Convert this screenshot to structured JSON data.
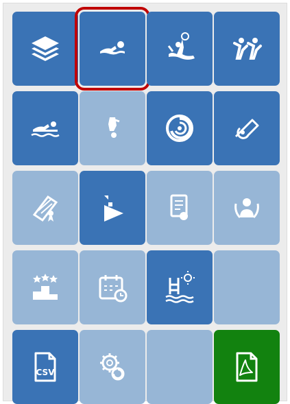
{
  "colors": {
    "panel_bg": "#ececec",
    "tile_dark": "#3a73b5",
    "tile_light": "#97b6d6",
    "tile_green": "#12820f",
    "selection_outline": "#c00000",
    "icon": "#ffffff"
  },
  "tiles": [
    {
      "icon": "layers-icon",
      "style": "dark"
    },
    {
      "icon": "swimmer-icon",
      "style": "dark",
      "selected": true
    },
    {
      "icon": "water-polo-icon",
      "style": "dark"
    },
    {
      "icon": "synchronized-swimming-icon",
      "style": "dark"
    },
    {
      "icon": "swimmer-waves-icon",
      "style": "dark"
    },
    {
      "icon": "diver-icon",
      "style": "light"
    },
    {
      "icon": "swirl-icon",
      "style": "dark"
    },
    {
      "icon": "whistle-icon",
      "style": "dark"
    },
    {
      "icon": "diploma-icon",
      "style": "light"
    },
    {
      "icon": "flag-play-icon",
      "style": "dark"
    },
    {
      "icon": "certificate-icon",
      "style": "light"
    },
    {
      "icon": "person-laurel-icon",
      "style": "light"
    },
    {
      "icon": "podium-icon",
      "style": "light"
    },
    {
      "icon": "calendar-clock-icon",
      "style": "light"
    },
    {
      "icon": "pool-ladder-icon",
      "style": "dark"
    },
    {
      "icon": "empty-tile",
      "style": "light"
    },
    {
      "icon": "csv-file-icon",
      "style": "dark",
      "label": "CSV"
    },
    {
      "icon": "settings-gears-icon",
      "style": "light"
    },
    {
      "icon": "empty-tile",
      "style": "light"
    },
    {
      "icon": "pdf-file-icon",
      "style": "green"
    }
  ]
}
